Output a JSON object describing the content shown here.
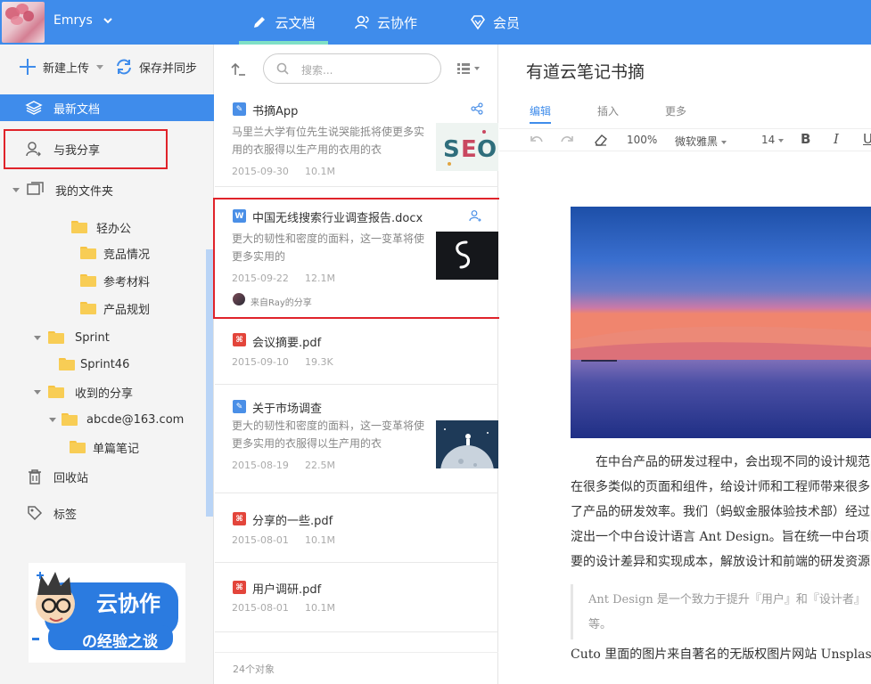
{
  "header": {
    "username": "Emrys",
    "nav": [
      {
        "label": "云文档",
        "icon": "pen-icon",
        "active": true
      },
      {
        "label": "云协作",
        "icon": "people-icon",
        "active": false
      },
      {
        "label": "会员",
        "icon": "vip-diamond-icon",
        "active": false
      }
    ],
    "colors": {
      "bar": "#3f8ceb",
      "active_underline": "#7fe0c6",
      "highlight_box": "#e0232a"
    }
  },
  "sidebar": {
    "new_upload": "新建上传",
    "save_sync": "保存并同步",
    "recent": "最新文档",
    "shared_with_me": "与我分享",
    "my_folders": "我的文件夹",
    "tree": {
      "light_office": "轻办公",
      "competitors": "竞品情况",
      "references": "参考材料",
      "product_plan": "产品规划",
      "sprint": "Sprint",
      "sprint46": "Sprint46",
      "received_shares": "收到的分享",
      "abcde": "abcde@163.com",
      "single_note": "单篇笔记"
    },
    "recycle": "回收站",
    "tags": "标签",
    "promo": {
      "line1": "云协作",
      "line2": "の经验之谈"
    }
  },
  "list": {
    "search_placeholder": "搜索...",
    "footer": "24个对象",
    "docs": [
      {
        "title": "书摘App",
        "snippet": "马里兰大学有位先生说哭能抵将使更多实用的衣服得以生产用的衣用的衣",
        "date": "2015-09-30",
        "size": "10.1M",
        "type": "note",
        "icon": "share-icon"
      },
      {
        "title": "中国无线搜索行业调查报告.docx",
        "snippet": "更大的韧性和密度的面料，这一变革将使更多实用的",
        "date": "2015-09-22",
        "size": "12.1M",
        "type": "word",
        "icon": "user-share-icon",
        "shared_from": "来自Ray的分享"
      },
      {
        "title": "会议摘要.pdf",
        "date": "2015-09-10",
        "size": "19.3K",
        "type": "pdf"
      },
      {
        "title": "关于市场调查",
        "snippet": "更大的韧性和密度的面料，这一变革将使更多实用的衣服得以生产用的衣",
        "date": "2015-08-19",
        "size": "22.5M",
        "type": "note"
      },
      {
        "title": "分享的一些.pdf",
        "date": "2015-08-01",
        "size": "10.1M",
        "type": "pdf"
      },
      {
        "title": "用户调研.pdf",
        "date": "2015-08-01",
        "size": "10.1M",
        "type": "pdf"
      }
    ]
  },
  "editor": {
    "title": "有道云笔记书摘",
    "tabs": [
      "编辑",
      "插入",
      "更多"
    ],
    "zoom": "100%",
    "font": "微软雅黑",
    "font_size": "14",
    "format": {
      "bold": "B",
      "italic": "I",
      "underline": "U"
    },
    "paragraph_lines": [
      "在中台产品的研发过程中，会出现不同的设计规范",
      "在很多类似的页面和组件，给设计师和工程师带来很多",
      "了产品的研发效率。我们（蚂蚁金服体验技术部）经过",
      "淀出一个中台设计语言 Ant Design。旨在统一中台项目",
      "要的设计差异和实现成本，解放设计和前端的研发资源"
    ],
    "quote_lines": [
      "Ant Design 是一个致力于提升『用户』和『设计者』",
      "等。"
    ],
    "last_line": "Cuto 里面的图片来自著名的无版权图片网站 Unsplash，"
  }
}
